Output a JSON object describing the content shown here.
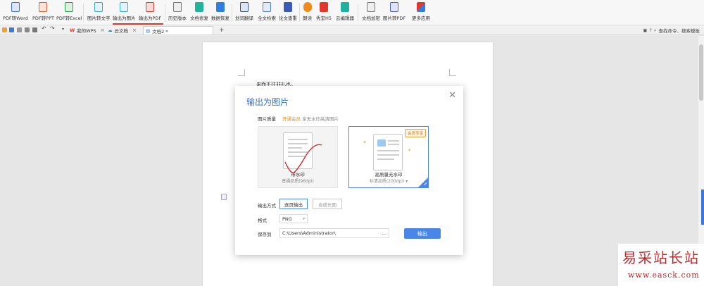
{
  "ribbon": {
    "buttons": [
      {
        "label": "PDF转Word",
        "icon": "pdf-to-word-icon",
        "color": "#3b6fd8"
      },
      {
        "label": "PDF转PPT",
        "icon": "pdf-to-ppt-icon",
        "color": "#e05a2b"
      },
      {
        "label": "PDF转Excel",
        "icon": "pdf-to-excel-icon",
        "color": "#2e9b4f"
      },
      {
        "label": "图片转文字",
        "icon": "image-to-text-icon",
        "color": "#3aa7d9"
      },
      {
        "label": "输出为图片",
        "icon": "export-image-icon",
        "color": "#3aa7d9"
      },
      {
        "label": "输出为PDF",
        "icon": "export-pdf-icon",
        "color": "#e0382c"
      },
      {
        "label": "历史版本",
        "icon": "history-icon",
        "color": "#777777"
      },
      {
        "label": "文档修复",
        "icon": "doc-repair-icon",
        "color": "#22b39a"
      },
      {
        "label": "数据恢复",
        "icon": "data-recover-icon",
        "color": "#2f7fe0"
      },
      {
        "label": "划词翻译",
        "icon": "translate-icon",
        "color": "#3c4f8a"
      },
      {
        "label": "全文检索",
        "icon": "full-search-icon",
        "color": "#4a7fd0"
      },
      {
        "label": "论文查重",
        "icon": "paper-check-icon",
        "color": "#3c5bb8"
      },
      {
        "label": "朗读",
        "icon": "read-aloud-icon",
        "color": "#f08a1c"
      },
      {
        "label": "秀堂H5",
        "icon": "h5-icon",
        "color": "#e0382c"
      },
      {
        "label": "云编辑器",
        "icon": "cloud-editor-icon",
        "color": "#1fb0a0"
      },
      {
        "label": "文档加密",
        "icon": "encrypt-icon",
        "color": "#777777"
      },
      {
        "label": "图片转PDF",
        "icon": "image-to-pdf-icon",
        "color": "#4a5bd0"
      },
      {
        "label": "更多应用",
        "icon": "more-apps-icon",
        "color": "#e0382c"
      }
    ]
  },
  "tabs": [
    {
      "label": "我的WPS",
      "icon": "wps-logo-icon",
      "active": false
    },
    {
      "label": "云文档",
      "icon": "cloud-icon",
      "active": false
    },
    {
      "label": "文档2 *",
      "icon": "doc-icon",
      "active": true
    }
  ],
  "search": {
    "label": "查找命令、搜索模板"
  },
  "document": {
    "text": "来而不往非礼也。"
  },
  "dialog": {
    "title": "输出为图片",
    "quality_label": "图片质量",
    "vip_link": "开通会员",
    "vip_hint": "享无水印高清图片",
    "options": [
      {
        "title": "带水印",
        "subtitle": "普通品质(96dpi)",
        "selected": false
      },
      {
        "title": "高质量无水印",
        "subtitle": "标清品质(200dpi)",
        "selected": true,
        "badge": "会员专享"
      }
    ],
    "mode_label": "输出方式",
    "modes": [
      {
        "label": "逐页输出",
        "selected": true
      },
      {
        "label": "合成长图",
        "selected": false
      }
    ],
    "format_label": "格式",
    "format_value": "PNG",
    "save_label": "保存到",
    "save_path": "C:\\Users\\Administrator\\",
    "browse": "...",
    "export_button": "输出"
  },
  "watermark": {
    "line1": "易采站长站",
    "line2": "www.easck.com"
  }
}
